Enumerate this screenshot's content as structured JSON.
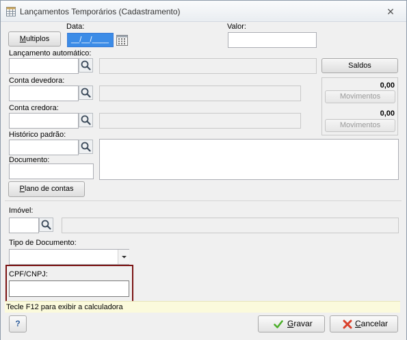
{
  "window": {
    "title": "Lançamentos Temporários (Cadastramento)",
    "close_glyph": "✕"
  },
  "form": {
    "multiplos_button": {
      "prefix": "",
      "accel": "M",
      "rest": "ultiplos"
    },
    "data_label": "Data:",
    "data_value": "__/__/____",
    "valor_label": "Valor:",
    "lancamento_label": "Lançamento automático:",
    "saldos_button": "Saldos",
    "conta_devedora_label": "Conta devedora:",
    "conta_credora_label": "Conta credora:",
    "historico_label": "Histórico padrão:",
    "documento_label": "Documento:",
    "plano_button": {
      "accel": "P",
      "rest": "lano de contas"
    },
    "devedora_amount": "0,00",
    "credora_amount": "0,00",
    "movimentos_label_1": "Movimentos",
    "movimentos_label_2": "Movimentos",
    "imovel_label": "Imóvel:",
    "tipo_documento_label": "Tipo de Documento:",
    "cpf_label": "CPF/CNPJ:"
  },
  "status": {
    "text": "Tecle F12 para exibir a calculadora"
  },
  "footer": {
    "help_glyph": "?",
    "gravar": {
      "accel": "G",
      "rest": "ravar"
    },
    "cancelar": {
      "accel": "C",
      "rest": "ancelar"
    }
  },
  "colors": {
    "accent_blue": "#3c8ce7",
    "highlight_border": "#7a1212",
    "status_bg": "#fbfadc"
  }
}
